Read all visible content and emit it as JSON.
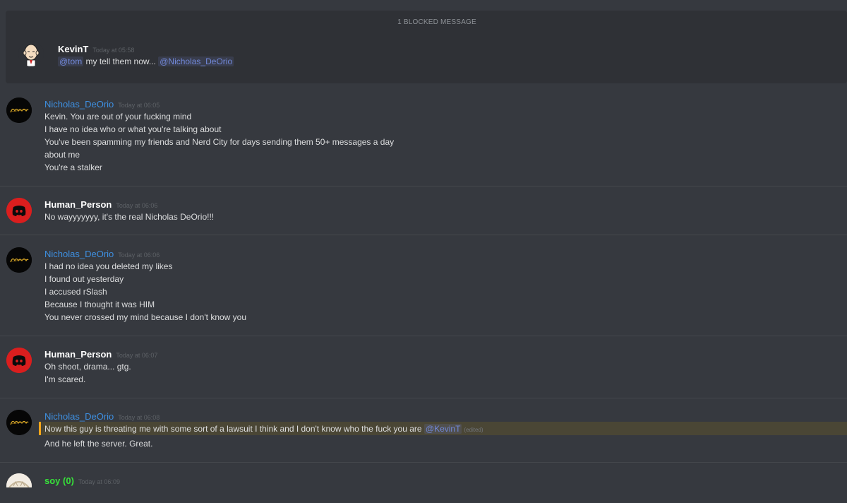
{
  "blocked": {
    "label": "1 BLOCKED MESSAGE"
  },
  "messages": [
    {
      "author": "KevinT",
      "timestamp": "Today at 05:58",
      "mention_1": "@tom",
      "text_mid": " my tell them now... ",
      "mention_2": "@Nicholas_DeOrio"
    },
    {
      "author": "Nicholas_DeOrio",
      "timestamp": "Today at 06:05",
      "lines": [
        "Kevin. You are out of your fucking mind",
        "I have no idea who or what you're talking about",
        "You've been spamming my friends and Nerd City for days sending them 50+ messages a day",
        "about me",
        "You're a stalker"
      ]
    },
    {
      "author": "Human_Person",
      "timestamp": "Today at 06:06",
      "lines": [
        "No wayyyyyyy, it's the real Nicholas DeOrio!!!"
      ]
    },
    {
      "author": "Nicholas_DeOrio",
      "timestamp": "Today at 06:06",
      "lines": [
        "I had no idea you deleted my likes",
        "I found out yesterday",
        "I accused rSlash",
        "Because I thought it was HIM",
        "You never crossed my mind because I don't know you"
      ]
    },
    {
      "author": "Human_Person",
      "timestamp": "Today at 06:07",
      "lines": [
        "Oh shoot, drama... gtg.",
        "I'm scared."
      ]
    },
    {
      "author": "Nicholas_DeOrio",
      "timestamp": "Today at 06:08",
      "highlight_text": "Now this guy is threating me with some sort of a lawsuit I think and I don't know who the fuck you are ",
      "highlight_mention": "@KevinT",
      "edited": "(edited)",
      "lines": [
        "And he left the server. Great."
      ]
    },
    {
      "author": "soy (0)",
      "timestamp": "Today at 06:09"
    }
  ],
  "colors": {
    "background": "#36393f",
    "blocked_bg": "#2f3136",
    "username_blue": "#3e8fe0",
    "username_green": "#37e13a",
    "mention": "#7289da",
    "highlight_bar": "#faa61a"
  },
  "icons": {
    "nicholas_avatar": "gold-script-logo-avatar",
    "human_avatar": "discord-logo-avatar",
    "kevin_avatar": "cartoon-bald-man-avatar",
    "soy_avatar": "anime-girl-avatar"
  }
}
